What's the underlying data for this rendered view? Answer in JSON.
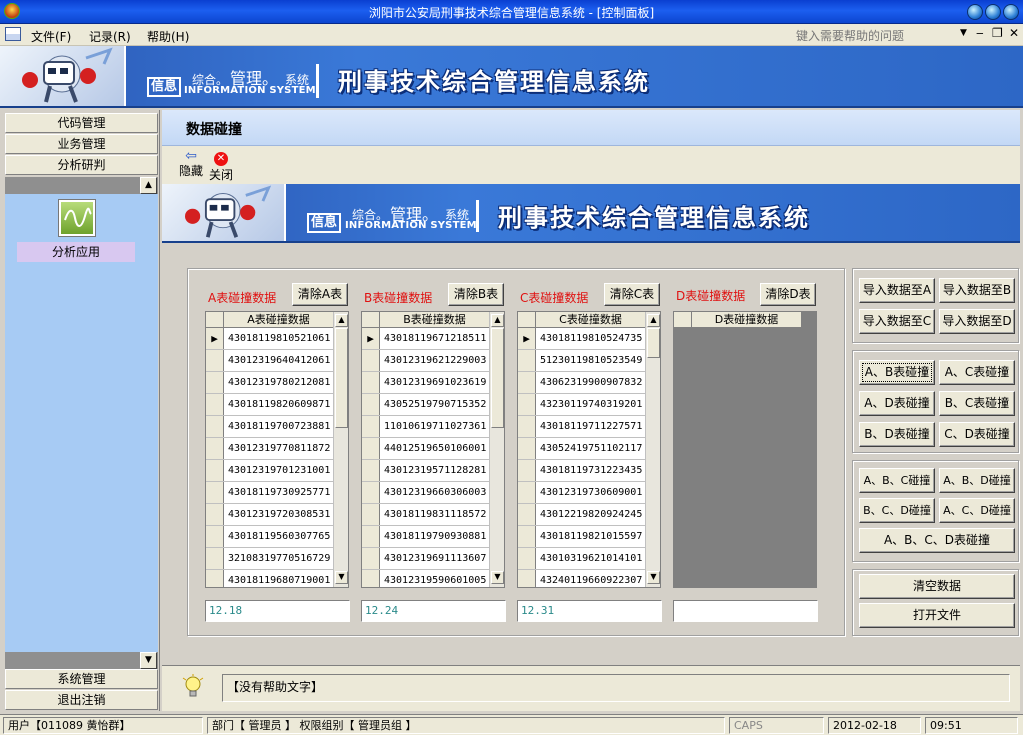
{
  "window": {
    "title": "浏阳市公安局刑事技术综合管理信息系统 - [控制面板]"
  },
  "menu": {
    "file": "文件(F)",
    "record": "记录(R)",
    "help": "帮助(H)",
    "help_question_placeholder": "键入需要帮助的问题"
  },
  "banner": {
    "xinxi": "信息",
    "zonghe": "综合。",
    "guanli": "管理。",
    "xitong": "系统",
    "english": "INFORMATION SYSTEM",
    "system_title": "刑事技术综合管理信息系统"
  },
  "nav": {
    "items_top": [
      "代码管理",
      "业务管理",
      "分析研判"
    ],
    "app_label": "分析应用",
    "items_bottom": [
      "系统管理",
      "退出注销"
    ]
  },
  "main": {
    "section_title": "数据碰撞",
    "toolbar": {
      "hide": "隐藏",
      "close": "关闭"
    }
  },
  "tables": [
    {
      "label": "A表碰撞数据",
      "clear_button": "清除A表",
      "column_header": "A表碰撞数据",
      "rows": [
        "43018119810521061",
        "43012319640412061",
        "43012319780212081",
        "43018119820609871",
        "43018119700723881",
        "43012319770811872",
        "43012319701231001",
        "43018119730925771",
        "43012319720308531",
        "43018119560307765",
        "32108319770516729",
        "43018119680719001"
      ],
      "total": "12.18"
    },
    {
      "label": "B表碰撞数据",
      "clear_button": "清除B表",
      "column_header": "B表碰撞数据",
      "rows": [
        "43018119671218511",
        "43012319621229003",
        "43012319691023619",
        "43052519790715352",
        "11010619711027361",
        "44012519650106001",
        "43012319571128281",
        "43012319660306003",
        "43018119831118572",
        "43018119790930881",
        "43012319691113607",
        "43012319590601005"
      ],
      "total": "12.24"
    },
    {
      "label": "C表碰撞数据",
      "clear_button": "清除C表",
      "column_header": "C表碰撞数据",
      "rows": [
        "43018119810524735",
        "51230119810523549",
        "43062319900907832",
        "43230119740319201",
        "43018119711227571",
        "43052419751102117",
        "43018119731223435",
        "43012319730609001",
        "43012219820924245",
        "43018119821015597",
        "43010319621014101",
        "43240119660922307"
      ],
      "total": "12.31"
    },
    {
      "label": "D表碰撞数据",
      "clear_button": "清除D表",
      "column_header": "D表碰撞数据",
      "rows": [],
      "total": ""
    }
  ],
  "right_panel": {
    "import": [
      "导入数据至A",
      "导入数据至B",
      "导入数据至C",
      "导入数据至D"
    ],
    "pairs": [
      "A、B表碰撞",
      "A、C表碰撞",
      "A、D表碰撞",
      "B、C表碰撞",
      "B、D表碰撞",
      "C、D表碰撞"
    ],
    "triples": [
      "A、B、C碰撞",
      "A、B、D碰撞",
      "B、C、D碰撞",
      "A、C、D碰撞"
    ],
    "all": "A、B、C、D表碰撞",
    "clear": "清空数据",
    "open": "打开文件"
  },
  "help": {
    "text": "【没有帮助文字】"
  },
  "status": {
    "user": "用户【011089 黄怡群】",
    "dept": "部门【 管理员 】 权限组别【 管理员组 】",
    "caps": "CAPS",
    "date": "2012-02-18",
    "time": "09:51"
  },
  "colors": {
    "banner_blue": "#3a79d8",
    "nav_panel": "#a7cbf4",
    "red_label": "#e01010",
    "total_text": "#2a8a8a"
  }
}
